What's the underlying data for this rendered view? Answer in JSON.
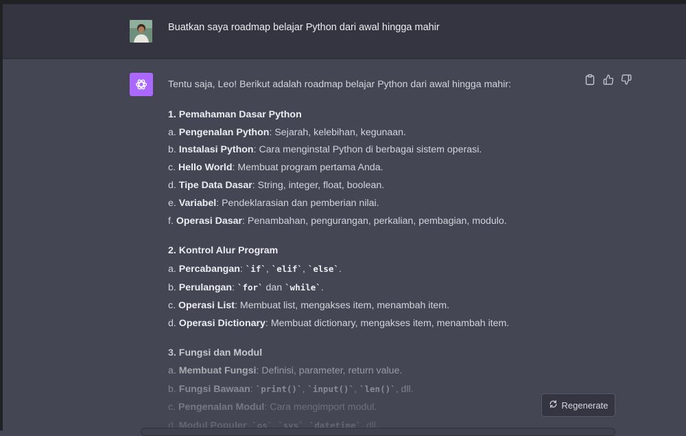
{
  "user_message": "Buatkan saya roadmap belajar Python dari awal hingga mahir",
  "assistant": {
    "intro": "Tentu saja, Leo! Berikut adalah roadmap belajar Python dari awal hingga mahir:",
    "sections": [
      {
        "title": "1. Pemahaman Dasar Python",
        "items": [
          {
            "prefix": "a. ",
            "bold": "Pengenalan Python",
            "rest": ": Sejarah, kelebihan, kegunaan."
          },
          {
            "prefix": "b. ",
            "bold": "Instalasi Python",
            "rest": ": Cara menginstal Python di berbagai sistem operasi."
          },
          {
            "prefix": "c. ",
            "bold": "Hello World",
            "rest": ": Membuat program pertama Anda."
          },
          {
            "prefix": "d. ",
            "bold": "Tipe Data Dasar",
            "rest": ": String, integer, float, boolean."
          },
          {
            "prefix": "e. ",
            "bold": "Variabel",
            "rest": ": Pendeklarasian dan pemberian nilai."
          },
          {
            "prefix": "f. ",
            "bold": "Operasi Dasar",
            "rest": ": Penambahan, pengurangan, perkalian, pembagian, modulo."
          }
        ]
      },
      {
        "title": "2. Kontrol Alur Program",
        "items": [
          {
            "prefix": "a. ",
            "bold": "Percabangan",
            "rest": ": ",
            "codes": [
              "`if`",
              "`elif`",
              "`else`"
            ],
            "tail": "."
          },
          {
            "prefix": "b. ",
            "bold": "Perulangan",
            "rest": ": ",
            "codes": [
              "`for`"
            ],
            "mid": " dan ",
            "codes2": [
              "`while`"
            ],
            "tail": "."
          },
          {
            "prefix": "c. ",
            "bold": "Operasi List",
            "rest": ": Membuat list, mengakses item, menambah item."
          },
          {
            "prefix": "d. ",
            "bold": "Operasi Dictionary",
            "rest": ": Membuat dictionary, mengakses item, menambah item."
          }
        ]
      },
      {
        "title": "3. Fungsi dan Modul",
        "items": [
          {
            "prefix": "a. ",
            "bold": "Membuat Fungsi",
            "rest": ": Definisi, parameter, return value."
          },
          {
            "prefix": "b. ",
            "bold": "Fungsi Bawaan",
            "rest": ": ",
            "codes": [
              "`print()`",
              "`input()`",
              "`len()`"
            ],
            "tail": ", dll."
          },
          {
            "prefix": "c. ",
            "bold": "Pengenalan Modul",
            "rest": ": Cara mengimport modul."
          },
          {
            "prefix": "d. ",
            "bold": "Modul Populer",
            "rest": ": ",
            "codes": [
              "`os`",
              "`sys`",
              "`datetime`"
            ],
            "tail": ", dll."
          }
        ]
      }
    ]
  },
  "actions": {
    "copy_icon": "clipboard-icon",
    "like_icon": "thumbs-up-icon",
    "dislike_icon": "thumbs-down-icon"
  },
  "regenerate": {
    "label": "Regenerate",
    "icon": "refresh-icon"
  },
  "colors": {
    "accent": "#ab68ff",
    "bg_user": "#343541",
    "bg_assistant": "#444654"
  }
}
